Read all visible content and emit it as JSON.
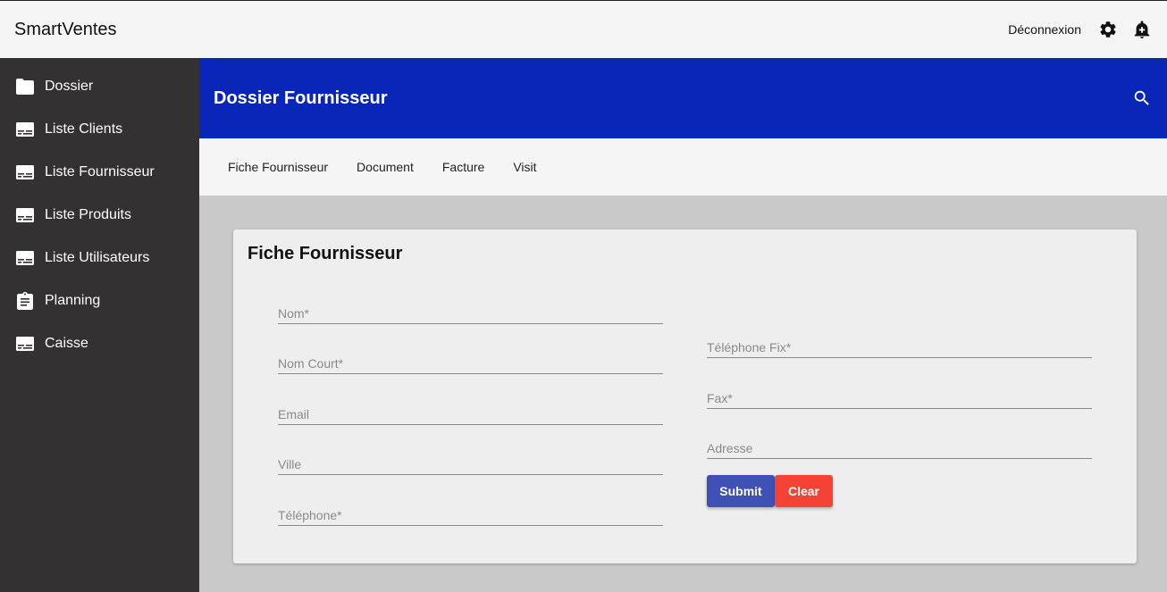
{
  "app": {
    "brand": "SmartVentes",
    "logout_label": "Déconnexion"
  },
  "sidebar": {
    "items": [
      {
        "label": "Dossier",
        "icon": "folder-icon"
      },
      {
        "label": "Liste Clients",
        "icon": "list-card-icon"
      },
      {
        "label": "Liste Fournisseur",
        "icon": "list-card-icon"
      },
      {
        "label": "Liste Produits",
        "icon": "list-card-icon"
      },
      {
        "label": "Liste Utilisateurs",
        "icon": "list-card-icon"
      },
      {
        "label": "Planning",
        "icon": "clipboard-icon"
      },
      {
        "label": "Caisse",
        "icon": "list-card-icon"
      }
    ]
  },
  "header": {
    "title": "Dossier Fournisseur"
  },
  "tabs": [
    {
      "label": "Fiche Fournisseur"
    },
    {
      "label": "Document"
    },
    {
      "label": "Facture"
    },
    {
      "label": "Visit"
    }
  ],
  "form": {
    "title": "Fiche Fournisseur",
    "left_fields": [
      {
        "placeholder": "Nom*",
        "value": ""
      },
      {
        "placeholder": "Nom Court*",
        "value": ""
      },
      {
        "placeholder": "Email",
        "value": ""
      },
      {
        "placeholder": "Ville",
        "value": ""
      },
      {
        "placeholder": "Téléphone*",
        "value": ""
      }
    ],
    "right_fields": [
      {
        "placeholder": "Téléphone Fix*",
        "value": ""
      },
      {
        "placeholder": "Fax*",
        "value": ""
      },
      {
        "placeholder": "Adresse",
        "value": ""
      }
    ],
    "submit_label": "Submit",
    "clear_label": "Clear"
  },
  "colors": {
    "header_bg": "#0a26b8",
    "sidebar_bg": "#333131",
    "submit": "#3f51b5",
    "clear": "#f44336"
  }
}
